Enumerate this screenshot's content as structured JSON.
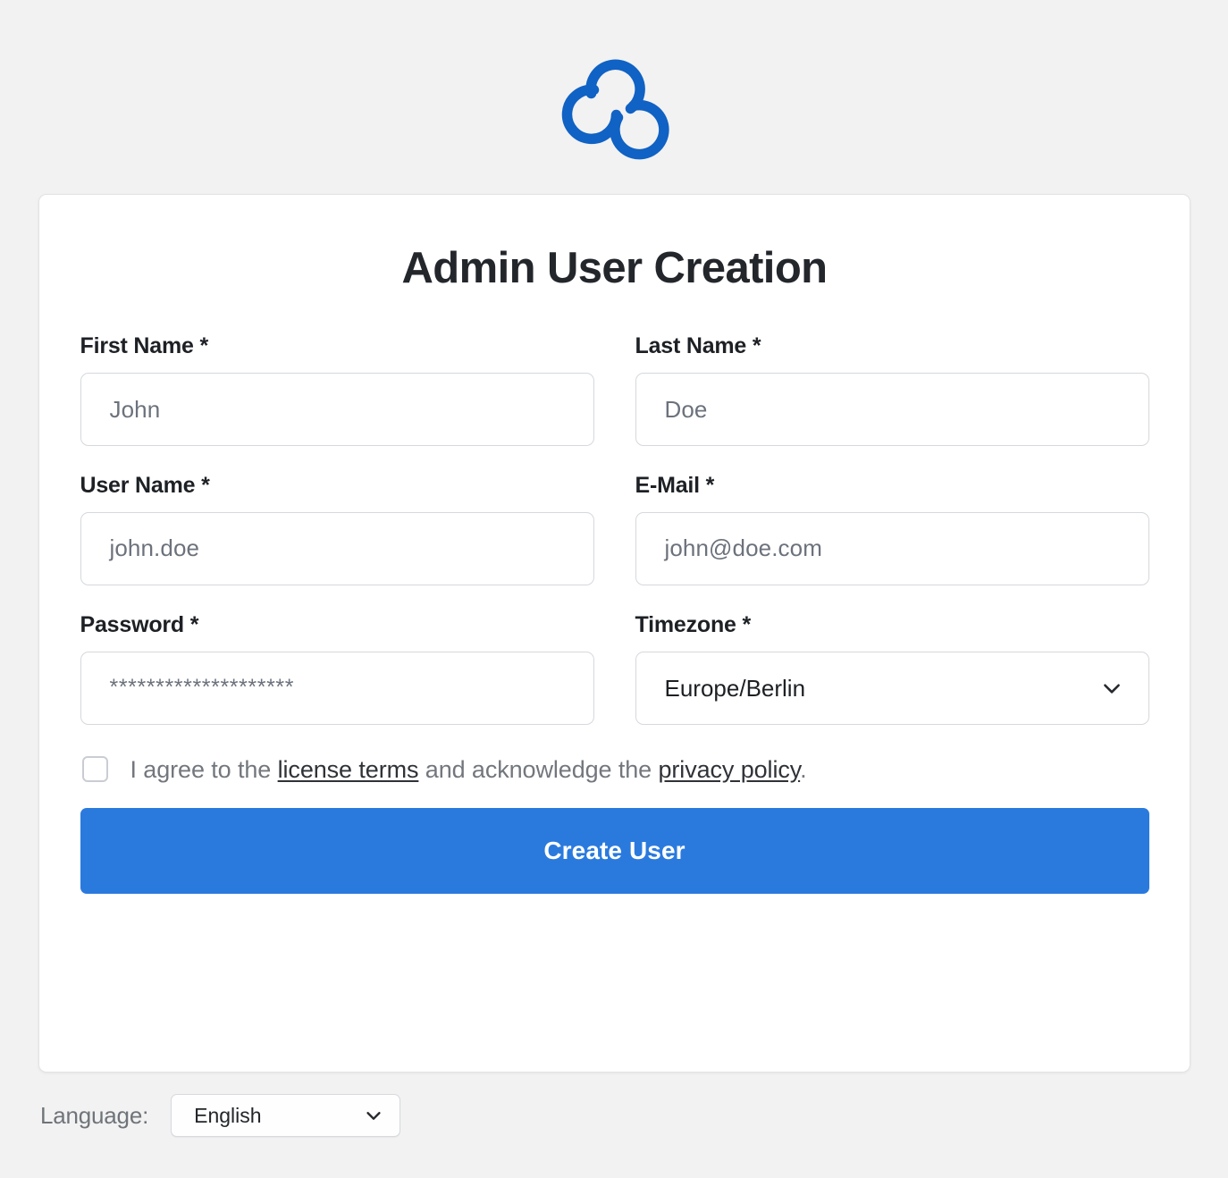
{
  "brand": {
    "logo_icon": "cloud-trefoil-logo",
    "logo_color": "#1062c4"
  },
  "card": {
    "title": "Admin User Creation"
  },
  "form": {
    "fields": [
      {
        "id": "first-name",
        "label": "First Name *",
        "placeholder": "John",
        "value": "",
        "type": "text"
      },
      {
        "id": "last-name",
        "label": "Last Name *",
        "placeholder": "Doe",
        "value": "",
        "type": "text"
      },
      {
        "id": "user-name",
        "label": "User Name *",
        "placeholder": "john.doe",
        "value": "",
        "type": "text"
      },
      {
        "id": "email",
        "label": "E-Mail *",
        "placeholder": "john@doe.com",
        "value": "",
        "type": "email"
      },
      {
        "id": "password",
        "label": "Password *",
        "placeholder": "********************",
        "value": "",
        "type": "password"
      },
      {
        "id": "timezone",
        "label": "Timezone *",
        "value": "Europe/Berlin",
        "type": "select",
        "icon": "chevron-down-icon"
      }
    ],
    "agreement": {
      "checked": false,
      "text_before": "I agree to the ",
      "link_license": "license terms",
      "text_middle": " and acknowledge the ",
      "link_privacy": "privacy policy",
      "text_after": "."
    },
    "submit_label": "Create User",
    "submit_color": "#2a7ade"
  },
  "footer": {
    "language_label": "Language:",
    "language_value": "English",
    "language_icon": "chevron-down-icon"
  }
}
